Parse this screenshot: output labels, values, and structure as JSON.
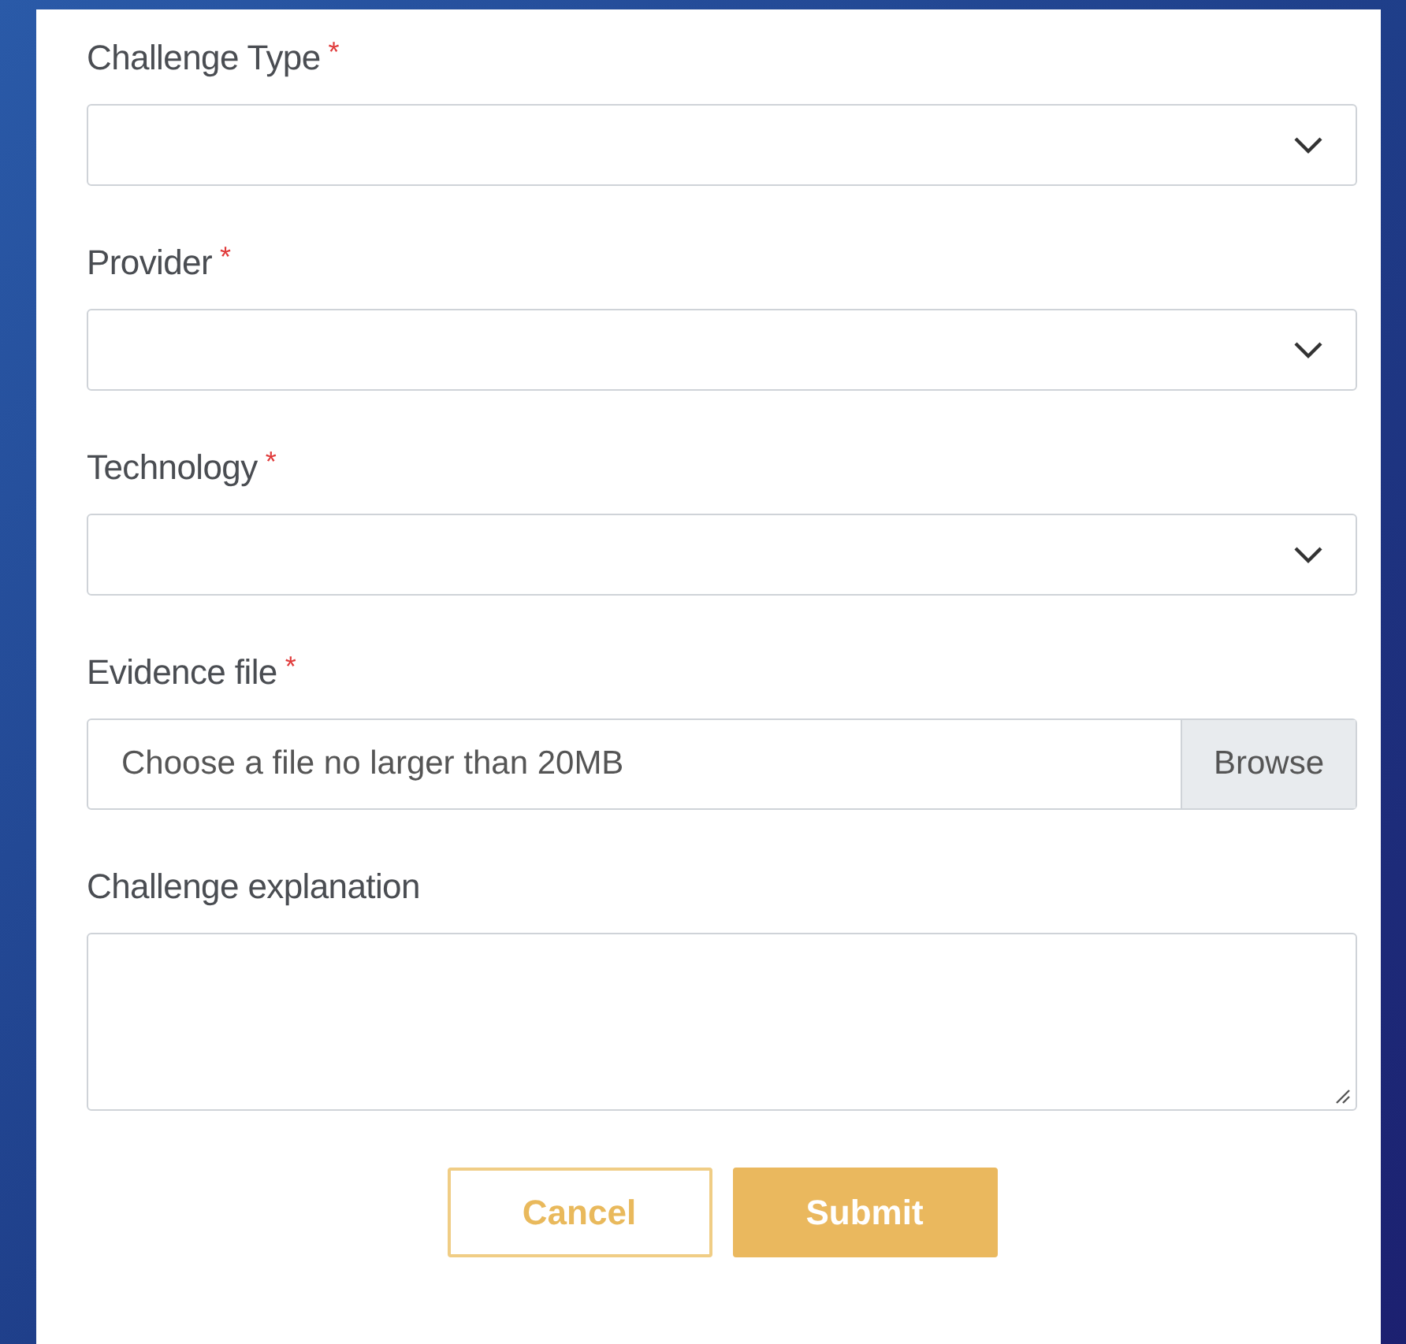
{
  "fields": [
    {
      "kind": "select",
      "label": "Challenge Type",
      "required_mark": "*"
    },
    {
      "kind": "select",
      "label": "Provider",
      "required_mark": "*"
    },
    {
      "kind": "select",
      "label": "Technology",
      "required_mark": "*"
    },
    {
      "kind": "file",
      "label": "Evidence file",
      "required_mark": "*",
      "placeholder": "Choose a file no larger than 20MB",
      "button": "Browse"
    },
    {
      "kind": "textarea",
      "label": "Challenge explanation"
    }
  ],
  "buttons": [
    {
      "label": "Cancel",
      "kind": "secondary"
    },
    {
      "label": "Submit",
      "kind": "primary"
    }
  ]
}
